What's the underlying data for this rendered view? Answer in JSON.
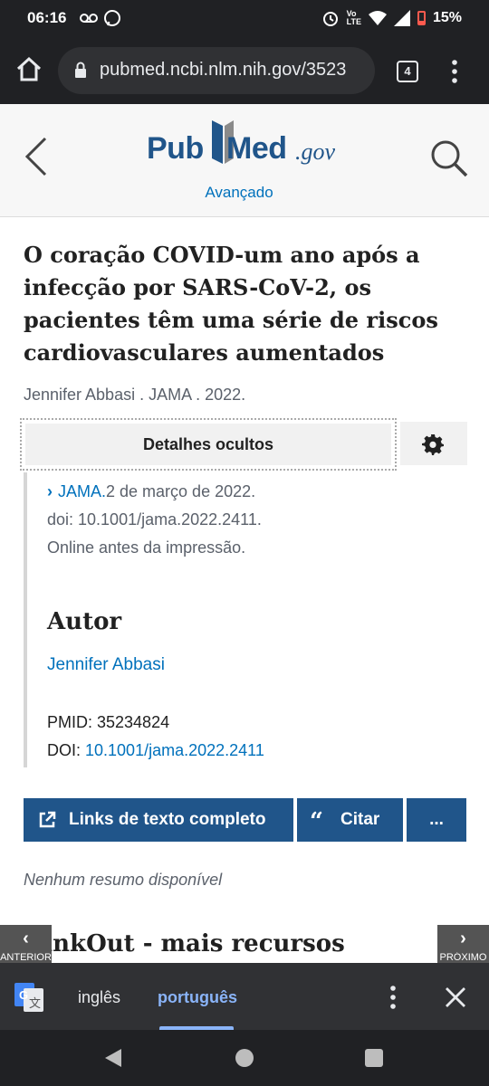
{
  "status_bar": {
    "time": "06:16",
    "left_icons": "⌕ ✆",
    "battery": "15%",
    "battery_color": "#ff5a4e"
  },
  "browser": {
    "url": "pubmed.ncbi.nlm.nih.gov/3523",
    "tab_count": "4",
    "toolbar_bg": "#202124"
  },
  "pubmed": {
    "logo_pub": "Pub",
    "logo_med": "Med",
    "logo_gov": ".gov",
    "advanced_label": "Avançado",
    "brand_color": "#20558a",
    "link_color": "#0071bc"
  },
  "article": {
    "title": "O coração COVID-um ano após a infecção por SARS-CoV-2, os pacientes têm uma série de riscos cardiovasculares aumentados",
    "short_citation": "Jennifer Abbasi . JAMA . 2022.",
    "details_label": "Detalhes ocultos",
    "journal": "JAMA.",
    "journal_date": "2 de março de 2022.",
    "doi_text": "doi: 10.1001/jama.2022.2411.",
    "epub_note": "Online antes da impressão.",
    "authors_heading": "Autor",
    "author_name": "Jennifer Abbasi",
    "pmid_text": "PMID: 35234824",
    "doi_label": "DOI: ",
    "doi_link": "10.1001/jama.2022.2411",
    "no_abstract": "Nenhum resumo disponível",
    "linkout_heading": "LinkOut - mais recursos"
  },
  "actions": {
    "full_text_label": "Links de texto completo",
    "cite_label": "Citar",
    "more_label": "..."
  },
  "pager": {
    "prev_label": "ANTERIOR",
    "next_label": "PRÓXIMO"
  },
  "translate": {
    "source_lang": "inglês",
    "target_lang": "português",
    "active_color": "#8ab4f8"
  }
}
